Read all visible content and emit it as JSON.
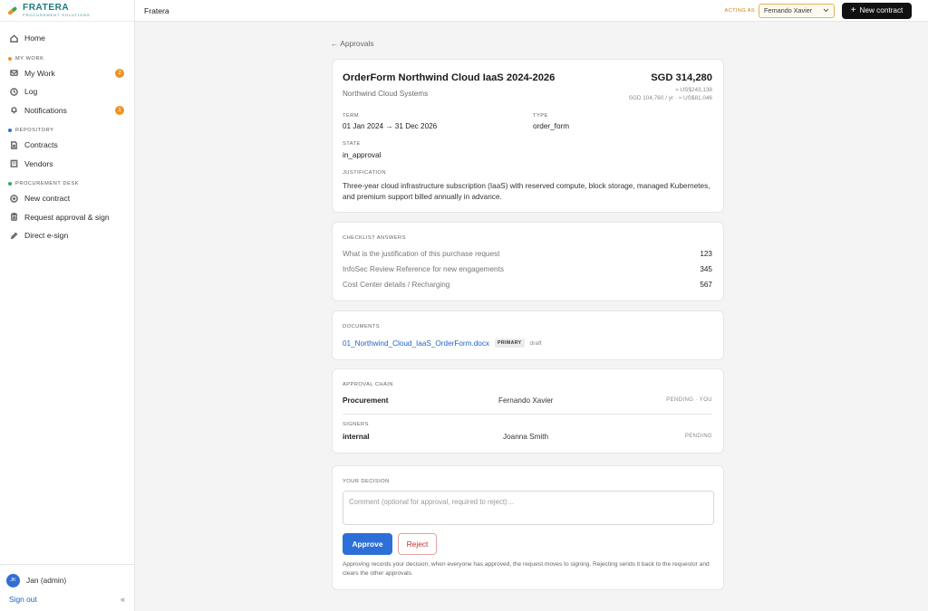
{
  "brand": {
    "name": "FRATERA",
    "tagline": "PROCUREMENT SOLUTIONS",
    "colors": {
      "teal": "#1e7a7a",
      "orange": "#f09124",
      "green": "#3aa55a"
    }
  },
  "sidebar": {
    "home": {
      "label": "Home",
      "icon": "home-icon"
    },
    "sections": [
      {
        "title": "MY WORK",
        "dot_color": "#f09124"
      },
      {
        "title": "REPOSITORY",
        "dot_color": "#2f6fd6"
      },
      {
        "title": "PROCUREMENT DESK",
        "dot_color": "#3aa55a"
      }
    ],
    "my_work": [
      {
        "label": "My Work",
        "badge": "2",
        "icon": "inbox-icon"
      },
      {
        "label": "Log",
        "icon": "clock-icon"
      },
      {
        "label": "Notifications",
        "badge": "1",
        "icon": "bell-icon"
      }
    ],
    "repository": [
      {
        "label": "Contracts",
        "icon": "document-icon"
      },
      {
        "label": "Vendors",
        "icon": "building-icon"
      }
    ],
    "procurement": [
      {
        "label": "New contract",
        "icon": "plus-circle-icon"
      },
      {
        "label": "Request approval & sign",
        "icon": "clipboard-icon"
      },
      {
        "label": "Direct e-sign",
        "icon": "pen-icon"
      }
    ],
    "user": {
      "initials": "JK",
      "name": "Jan (admin)"
    },
    "sign_out": "Sign out",
    "collapse": "«"
  },
  "topbar": {
    "title": "Fratera",
    "acting_as_label": "ACTING AS",
    "acting_as_value": "Fernando Xavier",
    "new_contract": "New contract"
  },
  "back_link": "← Approvals",
  "contract": {
    "title": "OrderForm Northwind Cloud IaaS 2024-2026",
    "vendor": "Northwind Cloud Systems",
    "amount": "SGD 314,280",
    "conversion": "≈ US$243,138",
    "annual": "SGD 104,760 / yr · ≈ US$81,046",
    "term_label": "TERM",
    "term_value": "01 Jan 2024 → 31 Dec 2026",
    "type_label": "TYPE",
    "type_value": "order_form",
    "state_label": "STATE",
    "state_value": "in_approval",
    "justification_label": "JUSTIFICATION",
    "justification": "Three-year cloud infrastructure subscription (IaaS) with reserved compute, block storage, managed Kubernetes, and premium support billed annually in advance."
  },
  "checklist": {
    "label": "CHECKLIST ANSWERS",
    "items": [
      {
        "question": "What is the justification of this purchase request",
        "answer": "123"
      },
      {
        "question": "InfoSec Review Reference for new engagements",
        "answer": "345"
      },
      {
        "question": "Cost Center details / Recharging",
        "answer": "567"
      }
    ]
  },
  "documents": {
    "label": "DOCUMENTS",
    "items": [
      {
        "name": "01_Northwind_Cloud_IaaS_OrderForm.docx",
        "tag": "PRIMARY",
        "status": "draft"
      }
    ]
  },
  "approval_chain": {
    "label": "APPROVAL CHAIN",
    "rows": [
      {
        "role": "Procurement",
        "person": "Fernando Xavier",
        "status": "PENDING · YOU"
      }
    ],
    "signers_label": "SIGNERS",
    "signers": [
      {
        "role": "internal",
        "person": "Joanna Smith",
        "status": "PENDING"
      }
    ]
  },
  "decision": {
    "label": "YOUR DECISION",
    "placeholder": "Comment (optional for approval, required to reject)…",
    "approve": "Approve",
    "reject": "Reject",
    "note": "Approving records your decision; when everyone has approved, the request moves to signing. Rejecting sends it back to the requestor and clears the other approvals."
  }
}
